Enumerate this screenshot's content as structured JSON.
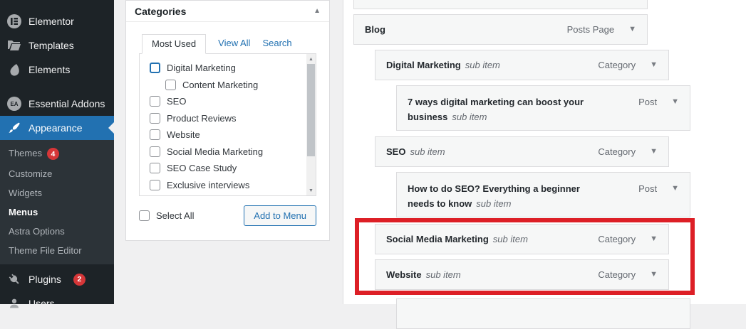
{
  "sidebar": {
    "top_items": [
      {
        "label": "Elementor",
        "icon": "elementor-icon"
      },
      {
        "label": "Templates",
        "icon": "templates-icon"
      },
      {
        "label": "Elements",
        "icon": "elements-icon"
      },
      {
        "label": "Essential Addons",
        "icon": "essential-addons-icon",
        "gap_before": true
      },
      {
        "label": "Appearance",
        "icon": "appearance-icon",
        "active": true
      }
    ],
    "appearance_submenu": [
      {
        "label": "Themes",
        "badge": "4"
      },
      {
        "label": "Customize"
      },
      {
        "label": "Widgets"
      },
      {
        "label": "Menus",
        "current": true
      },
      {
        "label": "Astra Options"
      },
      {
        "label": "Theme File Editor"
      }
    ],
    "bottom_items": [
      {
        "label": "Plugins",
        "icon": "plugins-icon",
        "badge": "2"
      },
      {
        "label": "Users",
        "icon": "users-icon"
      }
    ]
  },
  "categories_box": {
    "title": "Categories",
    "collapse_icon": "collapse-arrow-up",
    "tabs": [
      {
        "label": "Most Used",
        "active": true
      },
      {
        "label": "View All"
      },
      {
        "label": "Search"
      }
    ],
    "items": [
      {
        "label": "Digital Marketing",
        "checked": false,
        "focused": true
      },
      {
        "label": "Content Marketing",
        "checked": false,
        "indent": true
      },
      {
        "label": "SEO",
        "checked": false
      },
      {
        "label": "Product Reviews",
        "checked": false
      },
      {
        "label": "Website",
        "checked": false
      },
      {
        "label": "Social Media Marketing",
        "checked": false
      },
      {
        "label": "SEO Case Study",
        "checked": false
      },
      {
        "label": "Exclusive interviews",
        "checked": false
      }
    ],
    "select_all_label": "Select All",
    "select_all_checked": false,
    "add_button_label": "Add to Menu"
  },
  "menu_structure": {
    "items": [
      {
        "title": "",
        "sub": "",
        "type": "",
        "level": 0,
        "partial": "top"
      },
      {
        "title": "Blog",
        "sub": "",
        "type": "Posts Page",
        "level": 0
      },
      {
        "title": "Digital Marketing",
        "sub": "sub item",
        "type": "Category",
        "level": 1
      },
      {
        "title": "7 ways digital marketing can boost your business",
        "sub": "sub item",
        "type": "Post",
        "level": 2,
        "two_line": true
      },
      {
        "title": "SEO",
        "sub": "sub item",
        "type": "Category",
        "level": 1
      },
      {
        "title": "How to do SEO? Everything a beginner needs to know",
        "sub": "sub item",
        "type": "Post",
        "level": 2,
        "two_line": true
      },
      {
        "title": "Social Media Marketing",
        "sub": "sub item",
        "type": "Category",
        "level": 1,
        "highlighted": true
      },
      {
        "title": "Website",
        "sub": "sub item",
        "type": "Category",
        "level": 1,
        "highlighted": true
      },
      {
        "title": "",
        "sub": "",
        "type": "",
        "level": 2,
        "partial": "bottom"
      }
    ]
  },
  "colors": {
    "accent_blue": "#2271b1",
    "badge_red": "#d63638",
    "highlight_rectangle_red": "#dd1f26",
    "sidebar_bg": "#1d2327",
    "submenu_bg": "#2c3338",
    "menu_item_bg": "#f6f7f7",
    "border_gray": "#dcdcde"
  }
}
